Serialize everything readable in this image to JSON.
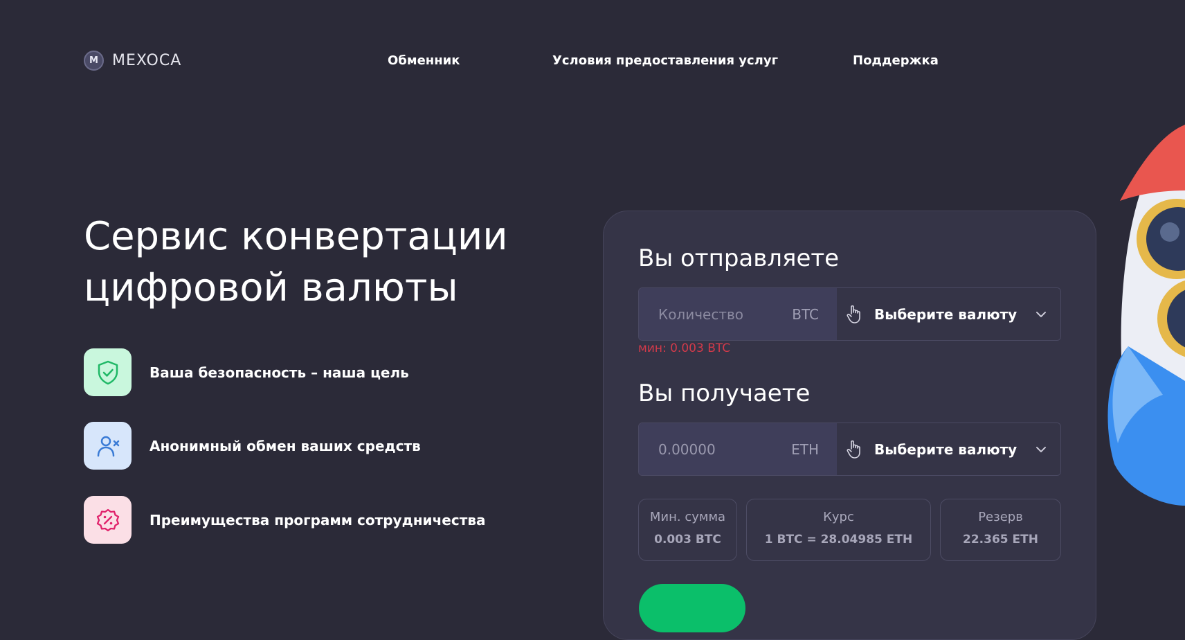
{
  "header": {
    "logo_letter": "M",
    "logo_text": "MEXOCA",
    "nav": [
      "Обменник",
      "Условия предоставления услуг",
      "Поддержка"
    ]
  },
  "hero": {
    "title_line1": "Сервис конвертации",
    "title_line2": "цифровой валюты",
    "features": [
      {
        "label": "Ваша безопасность – наша цель",
        "icon": "shield-check-icon",
        "color": "#c9f7dd"
      },
      {
        "label": "Анонимный обмен ваших средств",
        "icon": "user-x-icon",
        "color": "#d7e6fb"
      },
      {
        "label": "Преимущества программ сотрудничества",
        "icon": "discount-badge-icon",
        "color": "#fbdfe6"
      }
    ]
  },
  "exchange": {
    "send": {
      "title": "Вы отправляете",
      "placeholder": "Количество",
      "currency": "BTC",
      "select_label": "Выберите валюту",
      "min_note": "мин: 0.003 BTC"
    },
    "receive": {
      "title": "Вы получаете",
      "value": "0.00000",
      "currency": "ETH",
      "select_label": "Выберите валюту"
    },
    "info": [
      {
        "label": "Мин. сумма",
        "value": "0.003 BTC"
      },
      {
        "label": "Курс",
        "value": "1 BTC = 28.04985 ETH"
      },
      {
        "label": "Резерв",
        "value": "22.365 ETH"
      }
    ]
  },
  "colors": {
    "background": "#2b2a38",
    "card": "#353447",
    "accent_green": "#0bbf6a",
    "error_red": "#d33a4a"
  }
}
